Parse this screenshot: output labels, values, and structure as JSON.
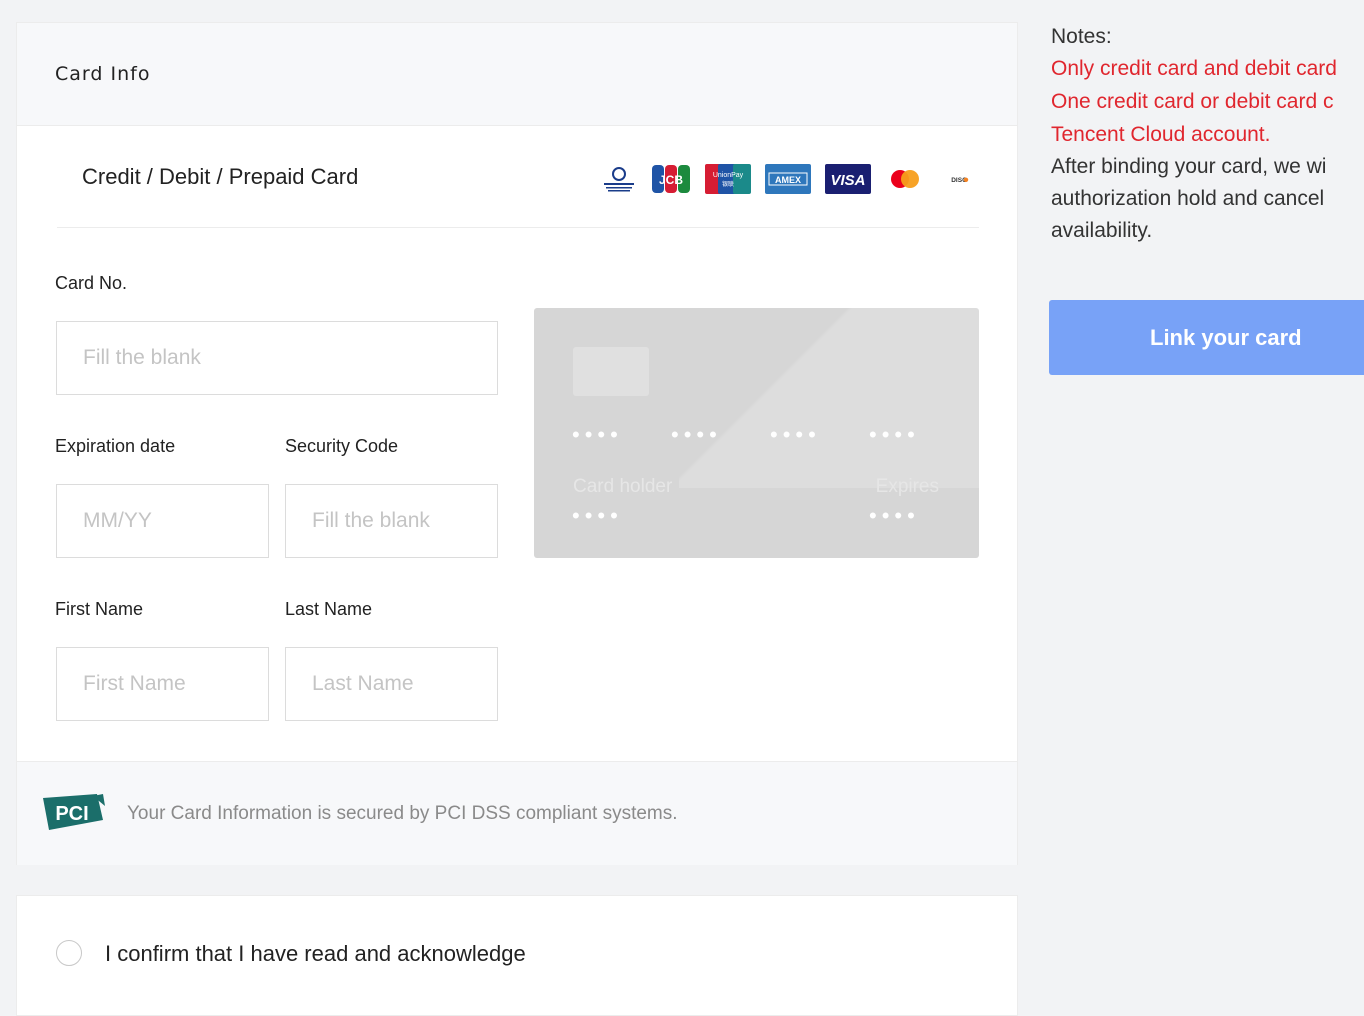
{
  "card_info": {
    "title": "Card Info",
    "method_label": "Credit / Debit / Prepaid Card",
    "card_brands": [
      "diners-club",
      "jcb",
      "unionpay",
      "amex",
      "visa",
      "mastercard",
      "discover"
    ],
    "card_no": {
      "label": "Card No.",
      "placeholder": "Fill the blank"
    },
    "expiration": {
      "label": "Expiration date",
      "placeholder": "MM/YY"
    },
    "security_code": {
      "label": "Security Code",
      "placeholder": "Fill the blank"
    },
    "first_name": {
      "label": "First Name",
      "placeholder": "First Name"
    },
    "last_name": {
      "label": "Last Name",
      "placeholder": "Last Name"
    },
    "preview": {
      "number_groups": [
        "••••",
        "••••",
        "••••",
        "••••"
      ],
      "holder_label": "Card holder",
      "holder_value": "••••",
      "expires_label": "Expires",
      "expires_value": "••••"
    },
    "pci_text": "Your Card Information is secured by PCI DSS compliant systems."
  },
  "confirm": {
    "text": "I confirm that I have read and acknowledge"
  },
  "notes": {
    "title": "Notes:",
    "red_lines": [
      "Only credit card and debit card",
      "One credit card or debit card c",
      "Tencent Cloud account."
    ],
    "gray_lines": [
      "After binding your card, we wi",
      "authorization hold and cancel",
      "availability."
    ]
  },
  "link_button": {
    "label": "Link your card"
  },
  "colors": {
    "accent": "#78a2f7",
    "warning": "#e0262e"
  }
}
